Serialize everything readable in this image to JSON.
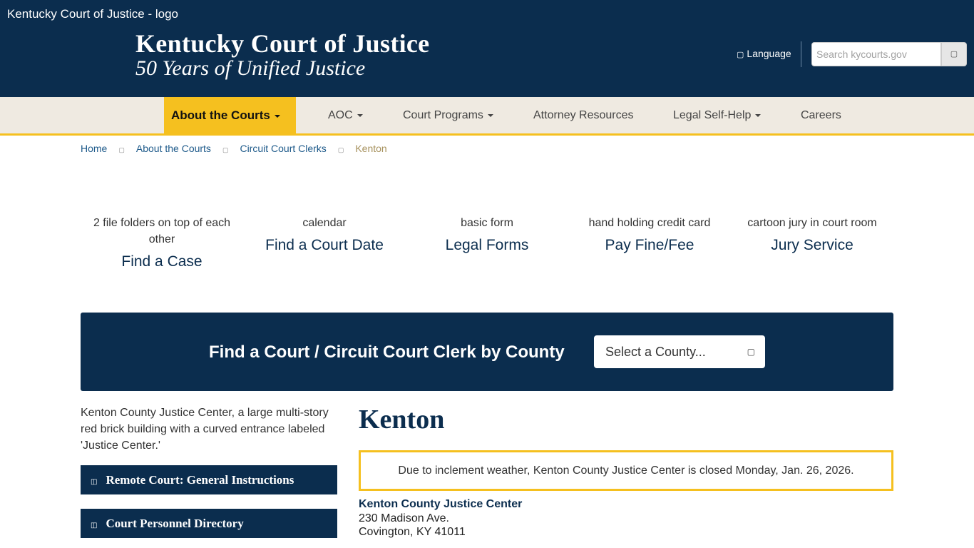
{
  "header": {
    "logo_alt": "Kentucky Court of Justice - logo",
    "title": "Kentucky Court of Justice",
    "subtitle": "50 Years of Unified Justice",
    "language_label": "Language",
    "search_placeholder": "Search kycourts.gov"
  },
  "nav": {
    "items": [
      {
        "label": "About the Courts",
        "dropdown": true,
        "active": true
      },
      {
        "label": "AOC",
        "dropdown": true
      },
      {
        "label": "Court Programs",
        "dropdown": true
      },
      {
        "label": "Attorney Resources",
        "dropdown": false
      },
      {
        "label": "Legal Self-Help",
        "dropdown": true
      },
      {
        "label": "Careers",
        "dropdown": false
      }
    ]
  },
  "breadcrumb": {
    "items": [
      "Home",
      "About the Courts",
      "Circuit Court Clerks",
      "Kenton"
    ]
  },
  "quick_links": [
    {
      "image_alt": "2 file folders on top of each other",
      "label": "Find a Case"
    },
    {
      "image_alt": "calendar",
      "label": "Find a Court Date"
    },
    {
      "image_alt": "basic form",
      "label": "Legal Forms"
    },
    {
      "image_alt": "hand holding credit card",
      "label": "Pay Fine/Fee"
    },
    {
      "image_alt": "cartoon jury in court room",
      "label": "Jury Service"
    }
  ],
  "finder": {
    "title": "Find a Court / Circuit Court Clerk by County",
    "select_value": "Select a County..."
  },
  "sidebar": {
    "image_alt": "Kenton County Justice Center, a large multi-story red brick building with a curved entrance labeled 'Justice Center.'",
    "buttons": [
      "Remote Court: General Instructions",
      "Court Personnel Directory"
    ]
  },
  "main": {
    "heading": "Kenton",
    "alert": "Due to inclement weather, Kenton County Justice Center is closed Monday, Jan. 26, 2026.",
    "address": {
      "name": "Kenton County Justice Center",
      "street": "230 Madison Ave.",
      "city": "Covington, KY 41011"
    }
  },
  "colors": {
    "navy": "#0b2d4e",
    "gold": "#f5c01f",
    "nav_bg": "#efeae1"
  }
}
